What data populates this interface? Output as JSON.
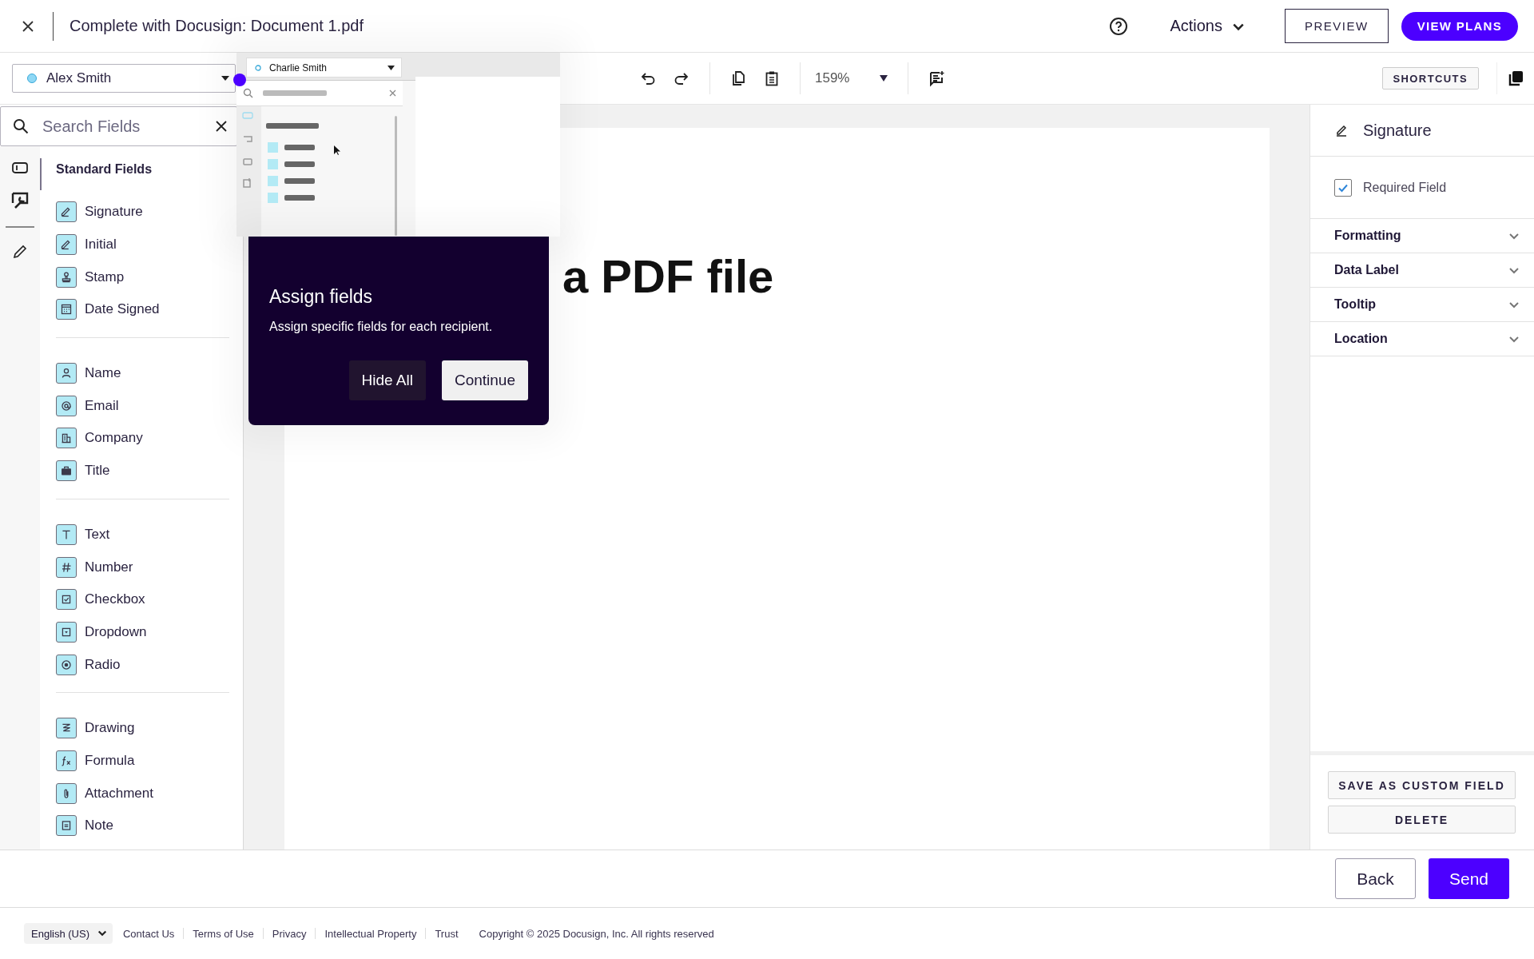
{
  "header": {
    "title": "Complete with Docusign: Document 1.pdf",
    "actions_label": "Actions",
    "preview_button": "PREVIEW",
    "plans_button": "VIEW PLANS"
  },
  "toolbar": {
    "recipient": {
      "name": "Alex Smith",
      "color": "#8fd8f5"
    },
    "zoom": "159%",
    "shortcuts_button": "SHORTCUTS"
  },
  "field_search": {
    "placeholder": "Search Fields"
  },
  "field_palette": {
    "heading": "Standard Fields",
    "groups": [
      [
        {
          "label": "Signature",
          "kind": "signature"
        },
        {
          "label": "Initial",
          "kind": "initial"
        },
        {
          "label": "Stamp",
          "kind": "stamp"
        },
        {
          "label": "Date Signed",
          "kind": "date"
        }
      ],
      [
        {
          "label": "Name",
          "kind": "name"
        },
        {
          "label": "Email",
          "kind": "email"
        },
        {
          "label": "Company",
          "kind": "company"
        },
        {
          "label": "Title",
          "kind": "title"
        }
      ],
      [
        {
          "label": "Text",
          "kind": "text"
        },
        {
          "label": "Number",
          "kind": "number"
        },
        {
          "label": "Checkbox",
          "kind": "checkbox"
        },
        {
          "label": "Dropdown",
          "kind": "dropdown"
        },
        {
          "label": "Radio",
          "kind": "radio"
        }
      ],
      [
        {
          "label": "Drawing",
          "kind": "drawing"
        },
        {
          "label": "Formula",
          "kind": "formula"
        },
        {
          "label": "Attachment",
          "kind": "attachment"
        },
        {
          "label": "Note",
          "kind": "note"
        }
      ]
    ]
  },
  "document": {
    "heading": "a PDF file"
  },
  "tour": {
    "title": "Assign fields",
    "text": "Assign specific fields for each recipient.",
    "preview_recipient": "Charlie Smith",
    "buttons": [
      {
        "label": "Hide All",
        "kind": "secondary"
      },
      {
        "label": "Continue",
        "kind": "primary"
      }
    ]
  },
  "properties": {
    "title": "Signature",
    "required": {
      "label": "Required Field",
      "checked": true
    },
    "sections": [
      {
        "label": "Formatting",
        "expanded": false
      },
      {
        "label": "Data Label",
        "expanded": false
      },
      {
        "label": "Tooltip",
        "expanded": false
      },
      {
        "label": "Location",
        "expanded": false
      }
    ],
    "buttons": [
      "SAVE AS CUSTOM FIELD",
      "DELETE"
    ]
  },
  "nav_buttons": [
    {
      "label": "Back",
      "kind": "secondary"
    },
    {
      "label": "Send",
      "kind": "primary"
    }
  ],
  "footer": {
    "language": "English (US)",
    "links": [
      "Contact Us",
      "Terms of Use",
      "Privacy",
      "Intellectual Property",
      "Trust"
    ],
    "copyright": "Copyright © 2025 Docusign, Inc. All rights reserved"
  }
}
